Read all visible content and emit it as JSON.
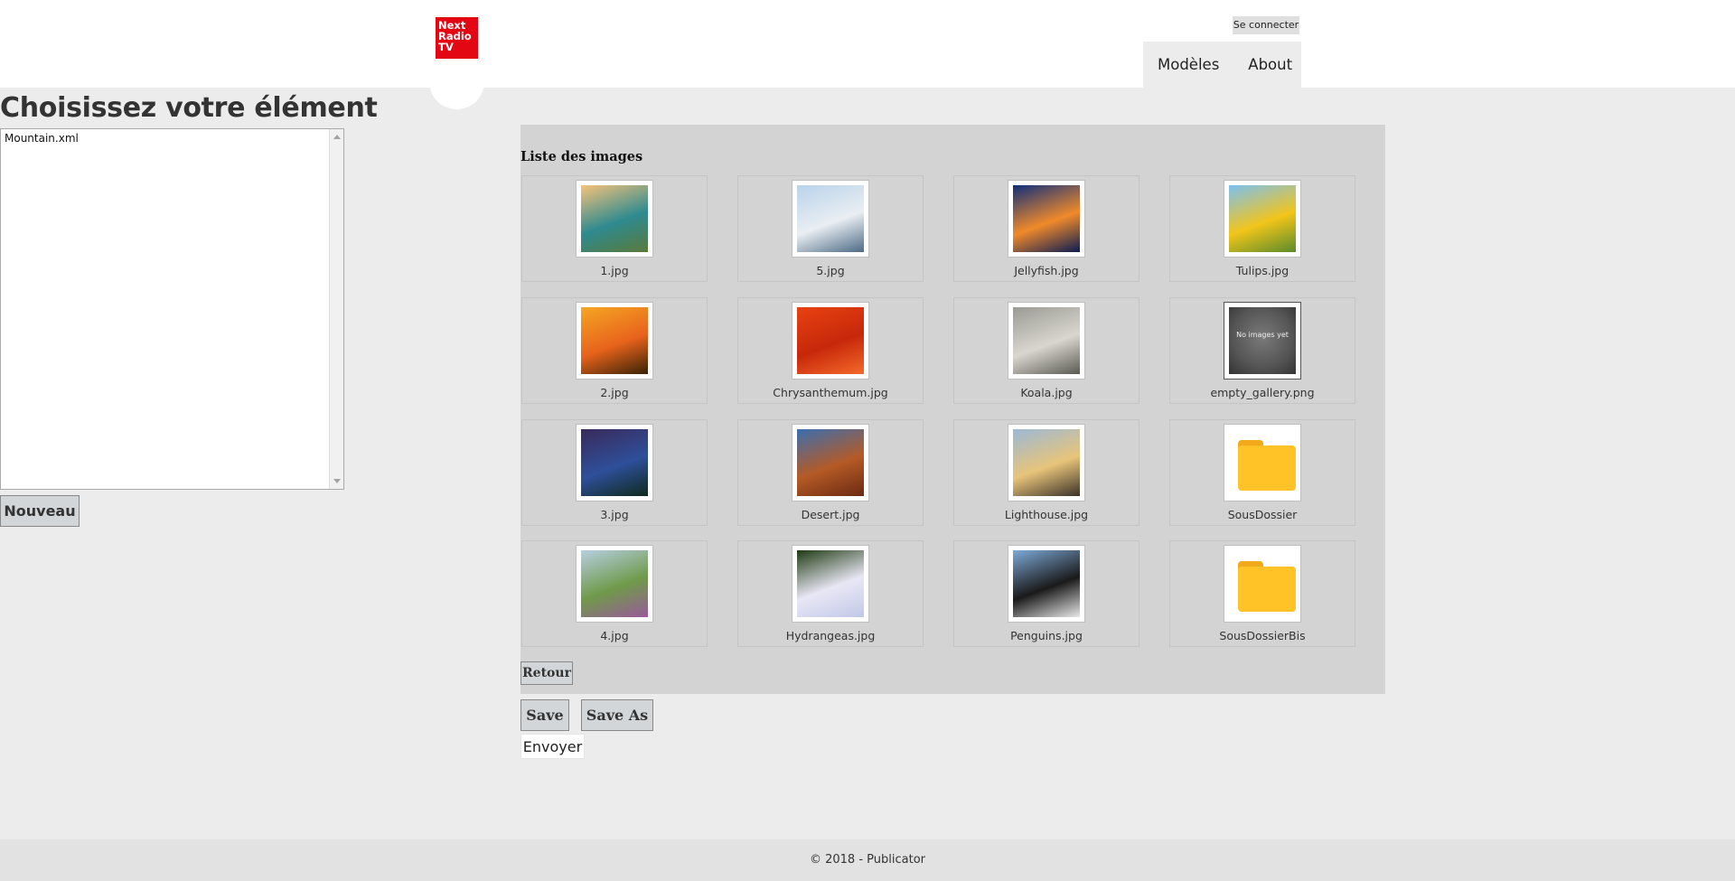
{
  "header": {
    "logo_lines": [
      "Next",
      "Radio",
      "TV"
    ],
    "login_label": "Se connecter",
    "nav": [
      {
        "label": "Modèles"
      },
      {
        "label": "About"
      }
    ]
  },
  "left_panel": {
    "title": "Choisissez votre élément",
    "files": [
      "Mountain.xml"
    ],
    "new_label": "Nouveau"
  },
  "gallery": {
    "title": "Liste des images",
    "items": [
      {
        "name": "1.jpg",
        "kind": "image",
        "icon": "coast-photo",
        "colors": [
          "#f6c27a",
          "#2e8a8f",
          "#5a7a3a"
        ]
      },
      {
        "name": "5.jpg",
        "kind": "image",
        "icon": "mountain-lake-photo",
        "colors": [
          "#b9d3ea",
          "#e9eef2",
          "#4c6a86"
        ]
      },
      {
        "name": "Jellyfish.jpg",
        "kind": "image",
        "icon": "jellyfish-photo",
        "colors": [
          "#0f2f7a",
          "#f08a2a",
          "#0a1c52"
        ]
      },
      {
        "name": "Tulips.jpg",
        "kind": "image",
        "icon": "tulips-photo",
        "colors": [
          "#7cc0f0",
          "#f2c51a",
          "#5a8a2a"
        ]
      },
      {
        "name": "2.jpg",
        "kind": "image",
        "icon": "sunset-birds-photo",
        "colors": [
          "#f5a623",
          "#e8631c",
          "#3a2206"
        ]
      },
      {
        "name": "Chrysanthemum.jpg",
        "kind": "image",
        "icon": "chrysanthemum-photo",
        "colors": [
          "#e84212",
          "#c7280a",
          "#f46a2a"
        ]
      },
      {
        "name": "Koala.jpg",
        "kind": "image",
        "icon": "koala-photo",
        "colors": [
          "#9a9a94",
          "#d9d6cf",
          "#5a5a52"
        ]
      },
      {
        "name": "empty_gallery.png",
        "kind": "empty",
        "icon": "no-images-icon",
        "colors": [
          "#555555",
          "#eeeeee",
          "#333333"
        ],
        "caption": "No images yet"
      },
      {
        "name": "3.jpg",
        "kind": "image",
        "icon": "seascape-photo",
        "colors": [
          "#3a2a5a",
          "#2e4f9a",
          "#0f2a1e"
        ]
      },
      {
        "name": "Desert.jpg",
        "kind": "image",
        "icon": "desert-photo",
        "colors": [
          "#3b6fb0",
          "#b55a26",
          "#6a2a12"
        ]
      },
      {
        "name": "Lighthouse.jpg",
        "kind": "image",
        "icon": "lighthouse-photo",
        "colors": [
          "#9bb9d6",
          "#e8c47a",
          "#3a3228"
        ]
      },
      {
        "name": "SousDossier",
        "kind": "folder",
        "icon": "folder-icon",
        "colors": [
          "#ffc328",
          "#f4a91d",
          "#ffffff"
        ]
      },
      {
        "name": "4.jpg",
        "kind": "image",
        "icon": "village-photo",
        "colors": [
          "#b6cfe2",
          "#6f9a4a",
          "#9a5a9a"
        ]
      },
      {
        "name": "Hydrangeas.jpg",
        "kind": "image",
        "icon": "hydrangea-photo",
        "colors": [
          "#1e3a12",
          "#e9e7f5",
          "#c0c8e8"
        ]
      },
      {
        "name": "Penguins.jpg",
        "kind": "image",
        "icon": "penguins-photo",
        "colors": [
          "#7eaad8",
          "#1a1a1a",
          "#e8e8e8"
        ]
      },
      {
        "name": "SousDossierBis",
        "kind": "folder",
        "icon": "folder-icon",
        "colors": [
          "#ffc328",
          "#f4a91d",
          "#ffffff"
        ]
      }
    ],
    "back_label": "Retour"
  },
  "actions": {
    "save_label": "Save",
    "save_as_label": "Save As",
    "send_label": "Envoyer"
  },
  "footer": {
    "text": "© 2018 - Publicator"
  }
}
